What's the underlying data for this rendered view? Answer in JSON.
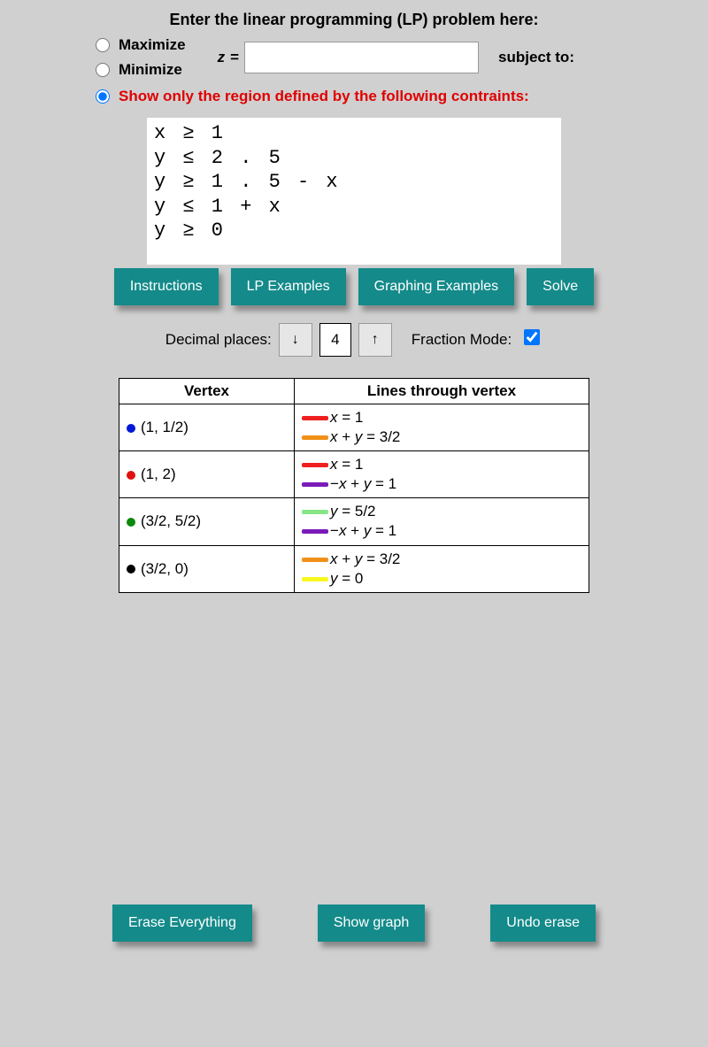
{
  "header": "Enter the linear programming (LP) problem here:",
  "options": {
    "maximize": "Maximize",
    "minimize": "Minimize",
    "z_var": "z",
    "equals": " =",
    "z_value": "",
    "subject_to": "subject to:",
    "show_region": "Show only the region defined by the following contraints:"
  },
  "constraints": "x ≥ 1\ny ≤ 2 . 5\ny ≥ 1 . 5 - x\ny ≤ 1 + x\ny ≥ 0",
  "buttons": {
    "instructions": "Instructions",
    "lp_examples": "LP Examples",
    "graphing_examples": "Graphing Examples",
    "solve": "Solve",
    "erase": "Erase Everything",
    "show_graph": "Show graph",
    "undo": "Undo erase"
  },
  "controls": {
    "decimal_label": "Decimal places:",
    "down": "↓",
    "decimal_value": "4",
    "up": "↑",
    "fraction_label": "Fraction Mode:"
  },
  "table": {
    "h_vertex": "Vertex",
    "h_lines": "Lines through vertex",
    "rows": [
      {
        "dot_color": "#0018d8",
        "vertex": "(1, 1/2)",
        "lines": [
          {
            "color": "#ef2020",
            "eq": "<span class='var'>x</span> = 1"
          },
          {
            "color": "#f09018",
            "eq": "<span class='var'>x</span> + <span class='var'>y</span> = 3/2"
          }
        ]
      },
      {
        "dot_color": "#e01010",
        "vertex": "(1, 2)",
        "lines": [
          {
            "color": "#ef2020",
            "eq": "<span class='var'>x</span> = 1"
          },
          {
            "color": "#7a1ab8",
            "eq": "−<span class='var'>x</span> + <span class='var'>y</span> = 1"
          }
        ]
      },
      {
        "dot_color": "#0a8a0a",
        "vertex": "(3/2, 5/2)",
        "lines": [
          {
            "color": "#86e686",
            "eq": "<span class='var'>y</span> = 5/2"
          },
          {
            "color": "#7a1ab8",
            "eq": "−<span class='var'>x</span> + <span class='var'>y</span> = 1"
          }
        ]
      },
      {
        "dot_color": "#000000",
        "vertex": "(3/2, 0)",
        "lines": [
          {
            "color": "#f09018",
            "eq": "<span class='var'>x</span> + <span class='var'>y</span> = 3/2"
          },
          {
            "color": "#f8f820",
            "eq": "<span class='var'>y</span> = 0"
          }
        ]
      }
    ]
  }
}
